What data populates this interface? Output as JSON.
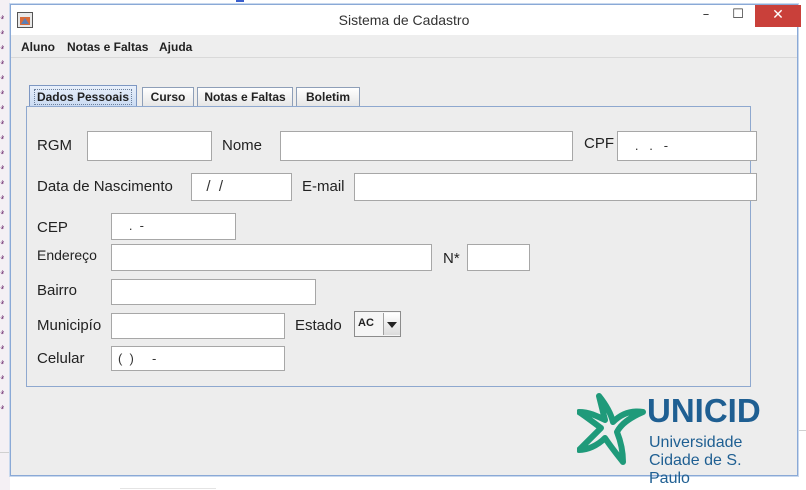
{
  "window": {
    "title": "Sistema de Cadastro",
    "controls": {
      "minimize": "–",
      "maximize": "☐",
      "close": "✕"
    }
  },
  "menubar": {
    "items": [
      "Aluno",
      "Notas e Faltas",
      "Ajuda"
    ]
  },
  "tabs": [
    {
      "label": "Dados Pessoais",
      "active": true
    },
    {
      "label": "Curso",
      "active": false
    },
    {
      "label": "Notas e Faltas",
      "active": false
    },
    {
      "label": "Boletim",
      "active": false
    }
  ],
  "form": {
    "rgm": {
      "label": "RGM",
      "value": ""
    },
    "nome": {
      "label": "Nome",
      "value": ""
    },
    "cpf": {
      "label": "CPF",
      "value": "   .   .   -"
    },
    "nascimento": {
      "label": "Data de Nascimento",
      "value": "  /  /"
    },
    "email": {
      "label": "E-mail",
      "value": ""
    },
    "cep": {
      "label": "CEP",
      "value": "   .  -"
    },
    "endereco": {
      "label": "Endereço",
      "value": ""
    },
    "numero": {
      "label": "N*",
      "value": ""
    },
    "bairro": {
      "label": "Bairro",
      "value": ""
    },
    "municipio": {
      "label": "Municipío",
      "value": ""
    },
    "estado": {
      "label": "Estado",
      "value": "AC"
    },
    "celular": {
      "label": "Celular",
      "value": "(  )     -"
    }
  },
  "logo": {
    "name": "UNICID",
    "line1": "Universidade",
    "line2": "Cidade de S. Paulo",
    "color_blue": "#1f5f92",
    "color_green": "#1f9a7a"
  },
  "colors": {
    "close_button": "#c9403a",
    "panel_border": "#8ea8cf",
    "window_bg": "#ededed"
  }
}
